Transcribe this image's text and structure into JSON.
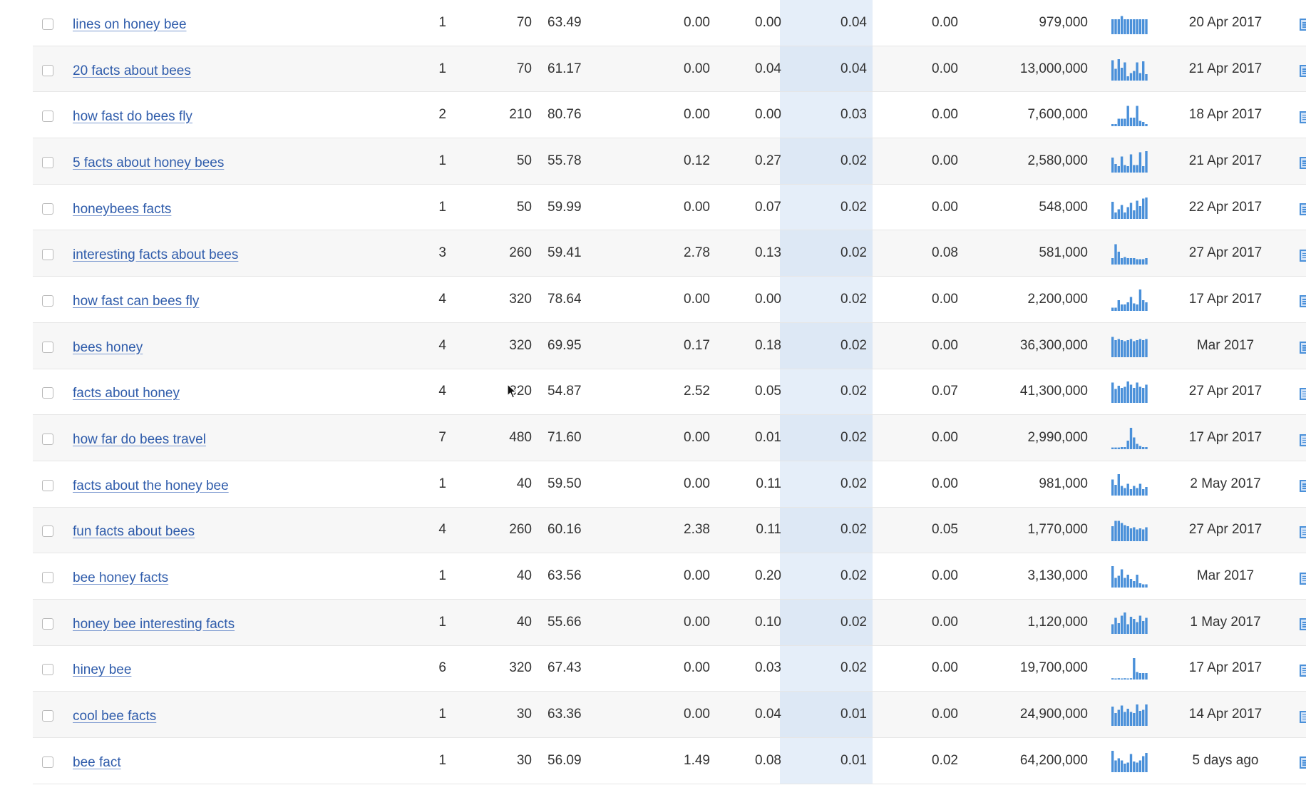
{
  "accent_color": "#4a90d9",
  "link_color": "#2f5cab",
  "rows": [
    {
      "keyword": "lines on honey bee",
      "kd": "1",
      "volume": "70",
      "cpc": "63.49",
      "m1": "0.00",
      "m2": "0.00",
      "m3": "0.04",
      "m4": "0.00",
      "results": "979,000",
      "trend": [
        0.7,
        0.7,
        0.7,
        0.85,
        0.7,
        0.7,
        0.7,
        0.7,
        0.7,
        0.7,
        0.7,
        0.7
      ],
      "date": "20 Apr 2017"
    },
    {
      "keyword": "20 facts about bees",
      "kd": "1",
      "volume": "70",
      "cpc": "61.17",
      "m1": "0.00",
      "m2": "0.04",
      "m3": "0.04",
      "m4": "0.00",
      "results": "13,000,000",
      "trend": [
        0.95,
        0.55,
        1.0,
        0.6,
        0.85,
        0.2,
        0.35,
        0.45,
        0.85,
        0.35,
        0.9,
        0.3
      ],
      "date": "21 Apr 2017"
    },
    {
      "keyword": "how fast do bees fly",
      "kd": "2",
      "volume": "210",
      "cpc": "80.76",
      "m1": "0.00",
      "m2": "0.00",
      "m3": "0.03",
      "m4": "0.00",
      "results": "7,600,000",
      "trend": [
        0.1,
        0.1,
        0.35,
        0.35,
        0.35,
        0.95,
        0.4,
        0.4,
        0.95,
        0.25,
        0.2,
        0.1
      ],
      "date": "18 Apr 2017"
    },
    {
      "keyword": "5 facts about honey bees",
      "kd": "1",
      "volume": "50",
      "cpc": "55.78",
      "m1": "0.12",
      "m2": "0.27",
      "m3": "0.02",
      "m4": "0.00",
      "results": "2,580,000",
      "trend": [
        0.7,
        0.4,
        0.3,
        0.75,
        0.35,
        0.3,
        0.85,
        0.35,
        0.35,
        0.95,
        0.3,
        1.0
      ],
      "date": "21 Apr 2017"
    },
    {
      "keyword": "honeybees facts",
      "kd": "1",
      "volume": "50",
      "cpc": "59.99",
      "m1": "0.00",
      "m2": "0.07",
      "m3": "0.02",
      "m4": "0.00",
      "results": "548,000",
      "trend": [
        0.8,
        0.3,
        0.45,
        0.65,
        0.3,
        0.55,
        0.75,
        0.4,
        0.85,
        0.6,
        0.95,
        1.0
      ],
      "date": "22 Apr 2017"
    },
    {
      "keyword": "interesting facts about bees",
      "kd": "3",
      "volume": "260",
      "cpc": "59.41",
      "m1": "2.78",
      "m2": "0.13",
      "m3": "0.02",
      "m4": "0.08",
      "results": "581,000",
      "trend": [
        0.3,
        0.95,
        0.6,
        0.3,
        0.35,
        0.3,
        0.3,
        0.3,
        0.25,
        0.25,
        0.25,
        0.3
      ],
      "date": "27 Apr 2017"
    },
    {
      "keyword": "how fast can bees fly",
      "kd": "4",
      "volume": "320",
      "cpc": "78.64",
      "m1": "0.00",
      "m2": "0.00",
      "m3": "0.02",
      "m4": "0.00",
      "results": "2,200,000",
      "trend": [
        0.15,
        0.15,
        0.5,
        0.3,
        0.3,
        0.4,
        0.65,
        0.35,
        0.3,
        1.0,
        0.5,
        0.4
      ],
      "date": "17 Apr 2017"
    },
    {
      "keyword": "bees honey",
      "kd": "4",
      "volume": "320",
      "cpc": "69.95",
      "m1": "0.17",
      "m2": "0.18",
      "m3": "0.02",
      "m4": "0.00",
      "results": "36,300,000",
      "trend": [
        0.95,
        0.8,
        0.85,
        0.8,
        0.75,
        0.8,
        0.85,
        0.75,
        0.8,
        0.85,
        0.8,
        0.85
      ],
      "date": "Mar 2017"
    },
    {
      "keyword": "facts about honey",
      "kd": "4",
      "volume": "320",
      "cpc": "54.87",
      "m1": "2.52",
      "m2": "0.05",
      "m3": "0.02",
      "m4": "0.07",
      "results": "41,300,000",
      "trend": [
        0.95,
        0.65,
        0.8,
        0.7,
        0.75,
        1.0,
        0.85,
        0.7,
        0.95,
        0.75,
        0.7,
        0.85
      ],
      "date": "27 Apr 2017"
    },
    {
      "keyword": "how far do bees travel",
      "kd": "7",
      "volume": "480",
      "cpc": "71.60",
      "m1": "0.00",
      "m2": "0.01",
      "m3": "0.02",
      "m4": "0.00",
      "results": "2,990,000",
      "trend": [
        0.08,
        0.08,
        0.08,
        0.1,
        0.1,
        0.4,
        1.0,
        0.55,
        0.25,
        0.15,
        0.1,
        0.1
      ],
      "date": "17 Apr 2017"
    },
    {
      "keyword": "facts about the honey bee",
      "kd": "1",
      "volume": "40",
      "cpc": "59.50",
      "m1": "0.00",
      "m2": "0.11",
      "m3": "0.02",
      "m4": "0.00",
      "results": "981,000",
      "trend": [
        0.75,
        0.5,
        1.0,
        0.45,
        0.35,
        0.55,
        0.3,
        0.45,
        0.35,
        0.55,
        0.3,
        0.4
      ],
      "date": "2 May 2017"
    },
    {
      "keyword": "fun facts about bees",
      "kd": "4",
      "volume": "260",
      "cpc": "60.16",
      "m1": "2.38",
      "m2": "0.11",
      "m3": "0.02",
      "m4": "0.05",
      "results": "1,770,000",
      "trend": [
        0.7,
        0.95,
        0.95,
        0.85,
        0.75,
        0.7,
        0.6,
        0.65,
        0.55,
        0.6,
        0.55,
        0.65
      ],
      "date": "27 Apr 2017"
    },
    {
      "keyword": "bee honey facts",
      "kd": "1",
      "volume": "40",
      "cpc": "63.56",
      "m1": "0.00",
      "m2": "0.20",
      "m3": "0.02",
      "m4": "0.00",
      "results": "3,130,000",
      "trend": [
        1.0,
        0.45,
        0.55,
        0.85,
        0.45,
        0.6,
        0.4,
        0.3,
        0.6,
        0.2,
        0.15,
        0.15
      ],
      "date": "Mar 2017"
    },
    {
      "keyword": "honey bee interesting facts",
      "kd": "1",
      "volume": "40",
      "cpc": "55.66",
      "m1": "0.00",
      "m2": "0.10",
      "m3": "0.02",
      "m4": "0.00",
      "results": "1,120,000",
      "trend": [
        0.45,
        0.75,
        0.5,
        0.85,
        1.0,
        0.45,
        0.8,
        0.7,
        0.55,
        0.85,
        0.6,
        0.75
      ],
      "date": "1 May 2017"
    },
    {
      "keyword": "hiney bee",
      "kd": "6",
      "volume": "320",
      "cpc": "67.43",
      "m1": "0.00",
      "m2": "0.03",
      "m3": "0.02",
      "m4": "0.00",
      "results": "19,700,000",
      "trend": [
        0.06,
        0.0,
        0.06,
        0.0,
        0.06,
        0.0,
        0.06,
        1.0,
        0.35,
        0.3,
        0.3,
        0.3
      ],
      "date": "17 Apr 2017"
    },
    {
      "keyword": "cool bee facts",
      "kd": "1",
      "volume": "30",
      "cpc": "63.36",
      "m1": "0.00",
      "m2": "0.04",
      "m3": "0.01",
      "m4": "0.00",
      "results": "24,900,000",
      "trend": [
        0.9,
        0.6,
        0.75,
        0.95,
        0.65,
        0.8,
        0.65,
        0.6,
        1.0,
        0.7,
        0.75,
        1.0
      ],
      "date": "14 Apr 2017"
    },
    {
      "keyword": "bee fact",
      "kd": "1",
      "volume": "30",
      "cpc": "56.09",
      "m1": "1.49",
      "m2": "0.08",
      "m3": "0.01",
      "m4": "0.02",
      "results": "64,200,000",
      "trend": [
        1.0,
        0.55,
        0.65,
        0.55,
        0.4,
        0.45,
        0.85,
        0.5,
        0.45,
        0.55,
        0.75,
        0.9
      ],
      "date": "5 days ago"
    }
  ]
}
